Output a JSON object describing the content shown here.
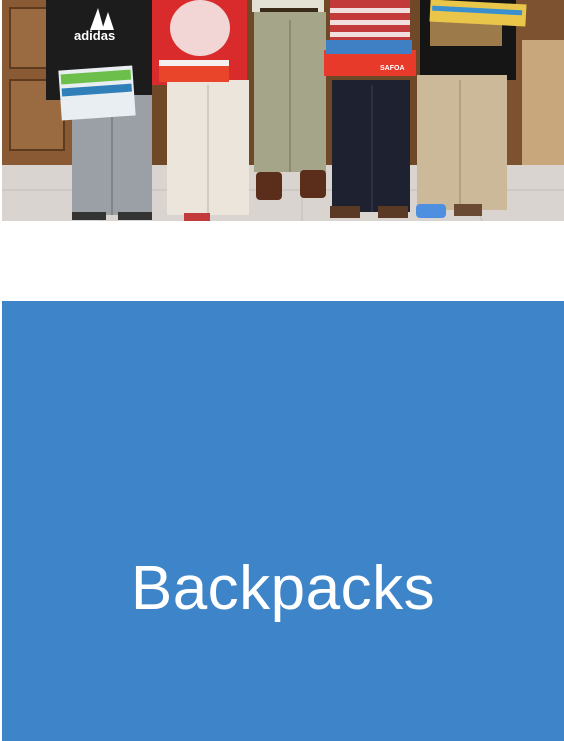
{
  "photo": {
    "shirt_text": "adidas",
    "box_label": "SAFOA",
    "palette": {
      "wall": "#6b4a2e",
      "floor": "#d9d4cf",
      "door_panel": "#8a5a34"
    }
  },
  "tile": {
    "title": "Backpacks",
    "background": "#3e84c8",
    "text_color": "#ffffff"
  }
}
